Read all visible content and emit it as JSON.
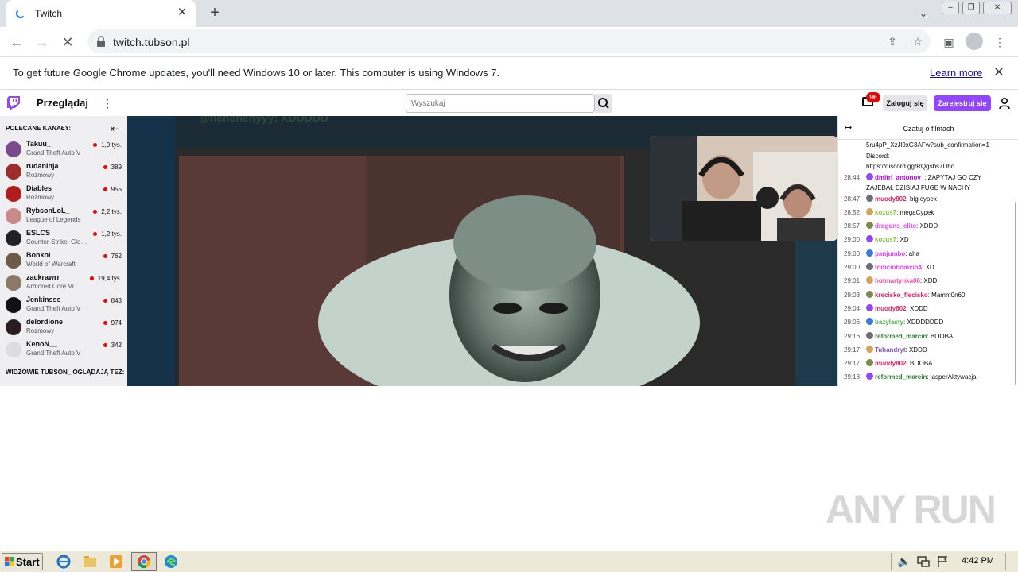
{
  "browser": {
    "tab_title": "Twitch",
    "url": "twitch.tubson.pl",
    "infobar_text": "To get future Google Chrome updates, you'll need Windows 10 or later. This computer is using Windows 7.",
    "learn_more": "Learn more"
  },
  "twitch_nav": {
    "browse": "Przeglądaj",
    "search_placeholder": "Wyszukaj",
    "inbox_count": "96",
    "login": "Zaloguj się",
    "signup": "Zarejestruj się"
  },
  "sidebar": {
    "heading": "POLECANE KANAŁY:",
    "channels": [
      {
        "name": "Takuu_",
        "game": "Grand Theft Auto V",
        "viewers": "1,9 tys.",
        "color": "#7a4b8c"
      },
      {
        "name": "rudaninja",
        "game": "Rozmowy",
        "viewers": "389",
        "color": "#9b2d2d"
      },
      {
        "name": "Diables",
        "game": "Rozmowy",
        "viewers": "955",
        "color": "#b11d1d"
      },
      {
        "name": "RybsonLoL_",
        "game": "League of Legends",
        "viewers": "2,2 tys.",
        "color": "#c98a8a"
      },
      {
        "name": "ESLCS",
        "game": "Counter-Strike: Global Offensive",
        "viewers": "1,2 tys.",
        "color": "#222222"
      },
      {
        "name": "Bonkol",
        "game": "World of Warcraft",
        "viewers": "762",
        "color": "#6d5a4b"
      },
      {
        "name": "zackrawrr",
        "game": "Armored Core VI",
        "viewers": "19,4 tys.",
        "color": "#8a7a6a"
      },
      {
        "name": "Jenkinsss",
        "game": "Grand Theft Auto V",
        "viewers": "843",
        "color": "#111111"
      },
      {
        "name": "delordione",
        "game": "Rozmowy",
        "viewers": "974",
        "color": "#2b1d1d"
      },
      {
        "name": "KenoN__",
        "game": "Grand Theft Auto V",
        "viewers": "342",
        "color": "#dddddd"
      }
    ],
    "heading2": "WIDZOWIE TUBSON_ OGLĄDAJĄ TEŻ:"
  },
  "video": {
    "overlay_text": "@hehehehyyy: XDDDDD"
  },
  "chat": {
    "title": "Czatuj o filmach",
    "lines": [
      {
        "time": "",
        "user": "",
        "user_color": "#0e0e10",
        "text": "5ru4pP_XzJl9xG3AFw?sub_confirmation=1"
      },
      {
        "time": "",
        "user": "",
        "user_color": "#0e0e10",
        "text": "Discord:"
      },
      {
        "time": "",
        "user": "",
        "user_color": "#0e0e10",
        "text": "https://discord.gg/RQgsbs7Uhd"
      },
      {
        "time": "28:44",
        "user": "dmitri_antonov_",
        "user_color": "#b500e0",
        "text": "ZAPYTAJ GO CZY"
      },
      {
        "time": "",
        "user": "",
        "user_color": "#0e0e10",
        "text": "ZAJEBAŁ DZISIAJ FUGE W NACHY"
      },
      {
        "time": "28:47",
        "user": "muody802",
        "user_color": "#e91e63",
        "text": "big cypek"
      },
      {
        "time": "28:52",
        "user": "kozus7",
        "user_color": "#8bc34a",
        "text": "megaCypek"
      },
      {
        "time": "28:57",
        "user": "dragons_elite",
        "user_color": "#e040fb",
        "text": "XDDD"
      },
      {
        "time": "29:00",
        "user": "kozus7",
        "user_color": "#8bc34a",
        "text": "XD"
      },
      {
        "time": "29:00",
        "user": "panjumbo",
        "user_color": "#e040fb",
        "text": "aha"
      },
      {
        "time": "29:00",
        "user": "tomciobomcio4",
        "user_color": "#e040fb",
        "text": "XD"
      },
      {
        "time": "29:01",
        "user": "hotmartynka06",
        "user_color": "#f0509b",
        "text": "XDD"
      },
      {
        "time": "29:03",
        "user": "krecisko_flecisko",
        "user_color": "#e91e63",
        "text": "Mamm0n60"
      },
      {
        "time": "29:04",
        "user": "muody802",
        "user_color": "#e91e63",
        "text": "XDDD"
      },
      {
        "time": "29:06",
        "user": "bazylasty",
        "user_color": "#4caf50",
        "text": "XDDDDDDD"
      },
      {
        "time": "29:16",
        "user": "reformed_marcin",
        "user_color": "#2e7d32",
        "text": "BOOBA"
      },
      {
        "time": "29:17",
        "user": "Tuhandryt",
        "user_color": "#7e57c2",
        "text": "XDDD"
      },
      {
        "time": "29:17",
        "user": "muody802",
        "user_color": "#e91e63",
        "text": "BOOBA"
      },
      {
        "time": "29:18",
        "user": "reformed_marcin",
        "user_color": "#2e7d32",
        "text": "jasperAktywacja"
      }
    ]
  },
  "watermark": "ANY RUN",
  "taskbar": {
    "start": "Start",
    "clock": "4:42 PM"
  }
}
